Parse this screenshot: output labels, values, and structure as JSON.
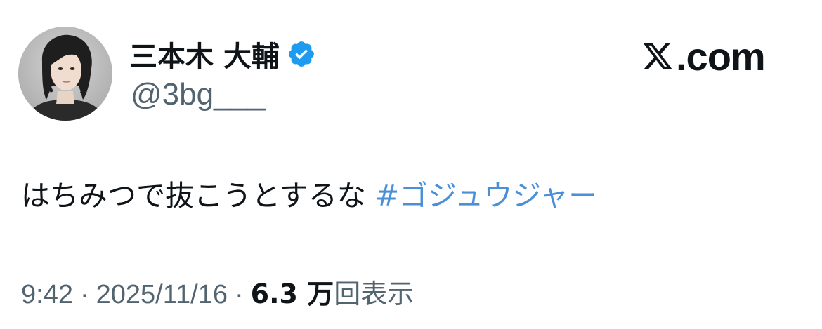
{
  "author": {
    "display_name": "三本木 大輔",
    "handle": "@3bg___",
    "verified": true,
    "avatar_icon": "profile-photo"
  },
  "brand": {
    "logo_icon": "x-logo-icon",
    "domain_suffix": ".com"
  },
  "tweet": {
    "text": "はちみつで抜こうとするな ",
    "hashtag": "#ゴジュウジャー"
  },
  "meta": {
    "time": "9:42",
    "separator": "·",
    "date": "2025/11/16",
    "views_count": "6.3 万",
    "views_label": "回表示"
  },
  "colors": {
    "hashtag": "#4a90d9",
    "verified_badge": "#1d9bf0",
    "secondary_text": "#536471",
    "primary_text": "#0f1419"
  }
}
